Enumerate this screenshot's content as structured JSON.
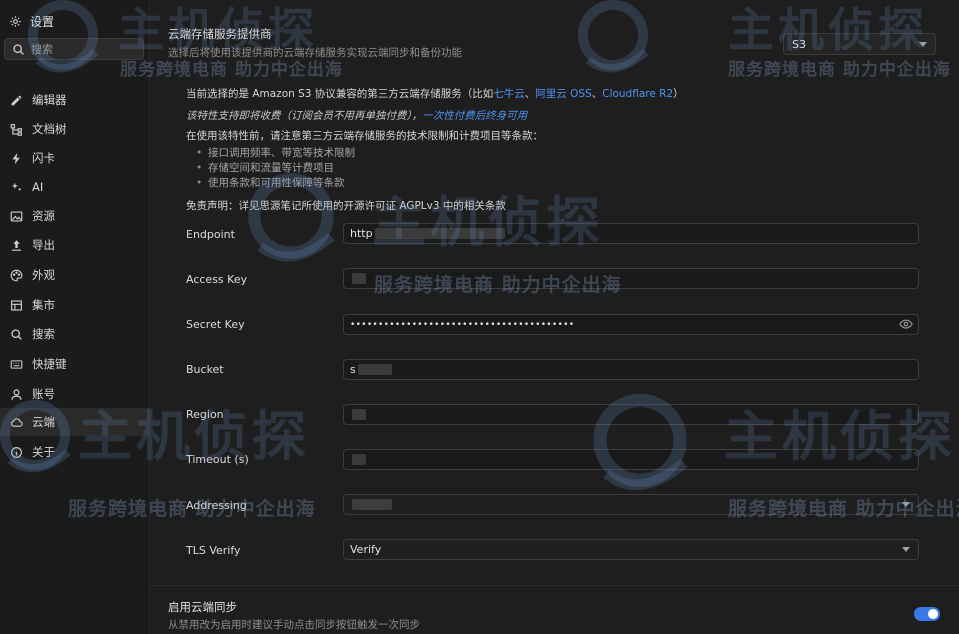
{
  "sidebar": {
    "settings_label": "设置",
    "search_placeholder": "搜索",
    "items": [
      {
        "label": "编辑器",
        "icon": "pencil-icon"
      },
      {
        "label": "文档树",
        "icon": "tree-icon"
      },
      {
        "label": "闪卡",
        "icon": "bolt-icon"
      },
      {
        "label": "AI",
        "icon": "sparkle-icon"
      },
      {
        "label": "资源",
        "icon": "image-icon"
      },
      {
        "label": "导出",
        "icon": "upload-icon"
      },
      {
        "label": "外观",
        "icon": "palette-icon"
      },
      {
        "label": "集市",
        "icon": "store-icon"
      },
      {
        "label": "搜索",
        "icon": "search-icon"
      },
      {
        "label": "快捷键",
        "icon": "keyboard-icon"
      },
      {
        "label": "账号",
        "icon": "user-icon"
      },
      {
        "label": "云端",
        "icon": "cloud-icon"
      },
      {
        "label": "关于",
        "icon": "info-icon"
      }
    ],
    "active_index": 11
  },
  "provider": {
    "title": "云端存储服务提供商",
    "description": "选择后将使用该提供商的云端存储服务实现云端同步和备份功能",
    "selected": "S3"
  },
  "notice": {
    "line1_prefix": "当前选择的是 Amazon S3 协议兼容的第三方云端存储服务（比如",
    "link_qiniu": "七牛云",
    "sep1": "、",
    "link_aliyun": "阿里云 OSS",
    "sep2": "、",
    "link_cloudflare": "Cloudflare R2",
    "line1_suffix": "）",
    "line2_italic": "该特性支持即将收费（订阅会员不用再单独付费），",
    "line2_link": "一次性付费后终身可用",
    "line3": "在使用该特性前，请注意第三方云端存储服务的技术限制和计费项目等条款：",
    "bullets": [
      "接口调用频率、带宽等技术限制",
      "存储空间和流量等计费项目",
      "使用条款和可用性保障等条款"
    ],
    "disclaimer": "免责声明：详见思源笔记所使用的开源许可证 AGPLv3 中的相关条款"
  },
  "fields": {
    "endpoint_label": "Endpoint",
    "endpoint_value": "http",
    "access_key_label": "Access Key",
    "secret_key_label": "Secret Key",
    "secret_key_value": "••••••••••••••••••••••••••••••••••••••••",
    "bucket_label": "Bucket",
    "bucket_value": "s",
    "region_label": "Region",
    "timeout_label": "Timeout (s)",
    "addressing_label": "Addressing",
    "tls_label": "TLS Verify",
    "tls_value": "Verify"
  },
  "sync": {
    "title": "启用云端同步",
    "description": "从禁用改为启用时建议手动点击同步按钮触发一次同步",
    "enabled": true
  },
  "watermark": {
    "brand": "主机侦探",
    "slogan": "服务跨境电商 助力中企出海"
  },
  "colors": {
    "accent": "#3b78e7",
    "link": "#4f93f3",
    "background": "#1e1e1e",
    "sidebar": "#1b1b1b"
  }
}
